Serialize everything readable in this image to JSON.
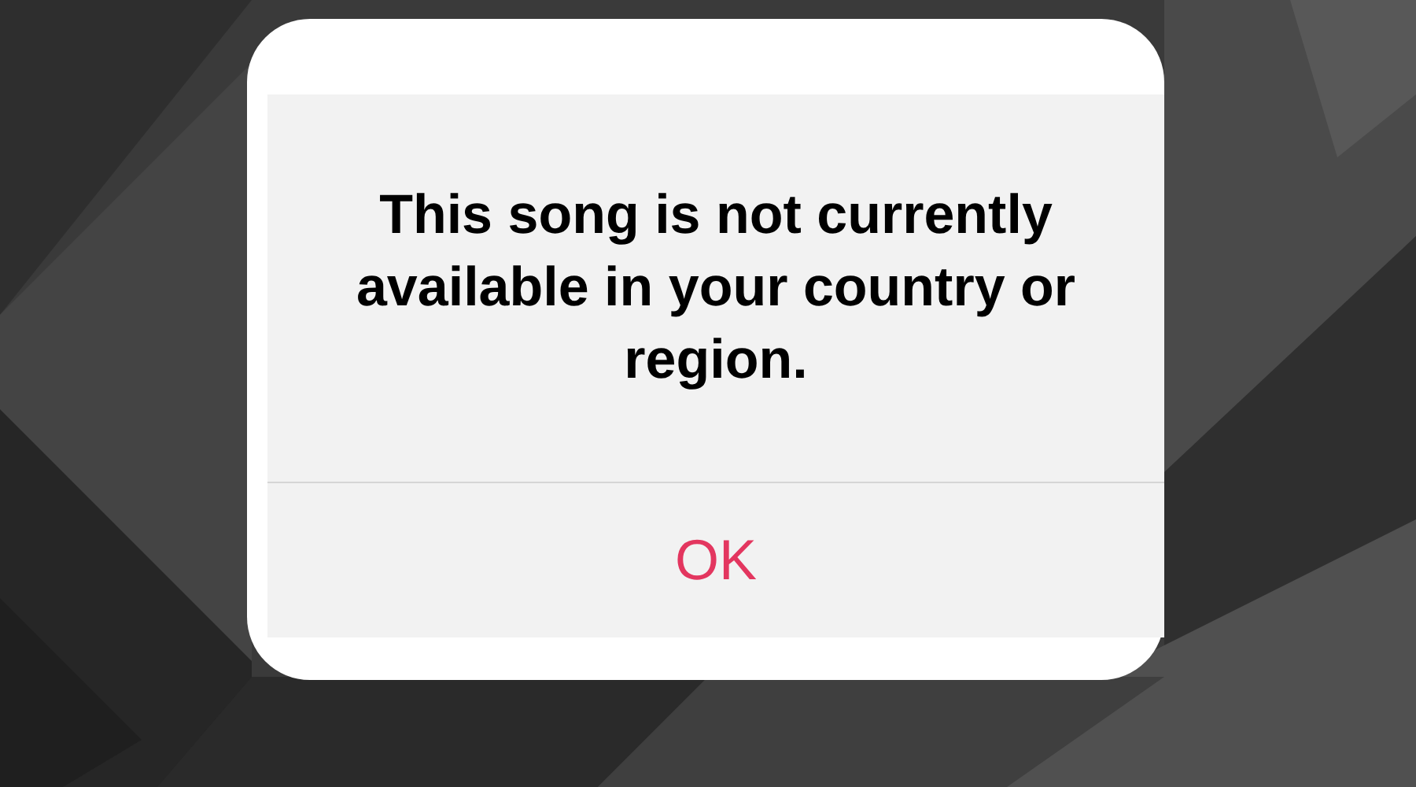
{
  "alert": {
    "message": "This song is not currently available in your country or region.",
    "buttons": [
      {
        "label": "OK"
      }
    ]
  }
}
